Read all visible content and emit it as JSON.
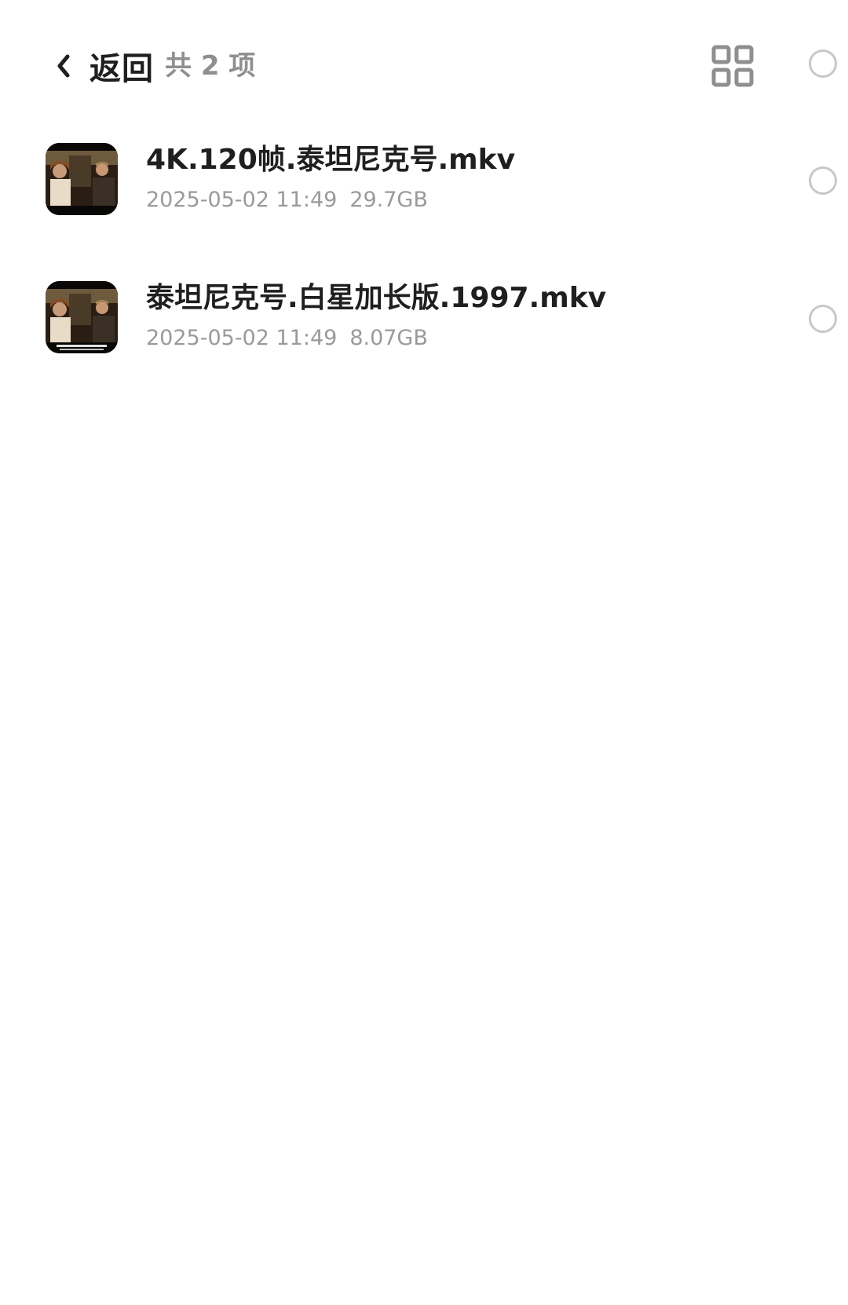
{
  "header": {
    "back_label": "返回",
    "count_label": "共 2 项",
    "back_icon": "chevron-left-icon",
    "grid_icon": "grid-view-icon",
    "select_icon": "circle-checkbox-icon"
  },
  "files": [
    {
      "name": "4K.120帧.泰坦尼克号.mkv",
      "date": "2025-05-02 11:49",
      "size": "29.7GB",
      "thumbnail_icon": "video-thumbnail"
    },
    {
      "name": "泰坦尼克号.白星加长版.1997.mkv",
      "date": "2025-05-02 11:49",
      "size": "8.07GB",
      "thumbnail_icon": "video-thumbnail"
    }
  ],
  "colors": {
    "title": "#1f1f1f",
    "secondary": "#9a9a9a",
    "icon_gray": "#8f8f8f",
    "checkbox_border": "#c8c8c8",
    "background": "#ffffff"
  }
}
